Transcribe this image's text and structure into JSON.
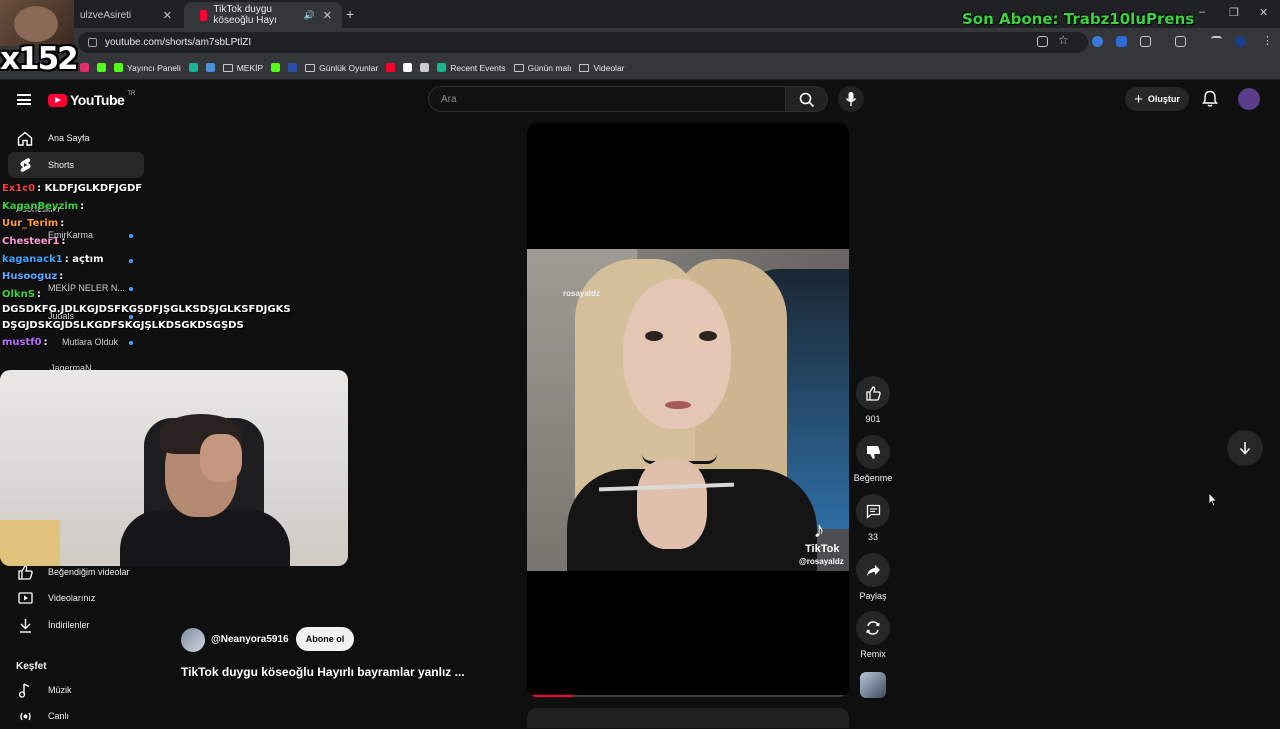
{
  "browser": {
    "tabs": [
      {
        "title": "ulzveAsireti"
      },
      {
        "title": "TikTok duygu köseoğlu Hayı"
      }
    ],
    "new_tab": "+",
    "url": "youtube.com/shorts/am7sbLPtlZI",
    "bookmarks": [
      {
        "label": "",
        "icon": "instagram-icon",
        "color": "#e1306c"
      },
      {
        "label": "",
        "icon": "kick-icon",
        "color": "#53fc18"
      },
      {
        "label": "Yayıncı Paneli",
        "icon": "kick-icon",
        "color": "#53fc18"
      },
      {
        "label": "",
        "icon": "app-icon",
        "color": "#1ab394"
      },
      {
        "label": "",
        "icon": "terminal-icon",
        "color": "#4a90d9"
      },
      {
        "label": "MEKİP",
        "icon": "folder-icon",
        "color": "#c7c7c7"
      },
      {
        "label": "",
        "icon": "kick-icon",
        "color": "#53fc18"
      },
      {
        "label": "",
        "icon": "app-icon",
        "color": "#2b4fa8"
      },
      {
        "label": "Günlük Oyunlar",
        "icon": "folder-icon",
        "color": "#c7c7c7"
      },
      {
        "label": "",
        "icon": "youtube-icon",
        "color": "#ff0033"
      },
      {
        "label": "",
        "icon": "game-icon",
        "color": "#ffffff"
      },
      {
        "label": "",
        "icon": "chatgpt-icon",
        "color": "#cccccc"
      },
      {
        "label": "Recent Events",
        "icon": "app-icon",
        "color": "#1ab394"
      },
      {
        "label": "Günün malı",
        "icon": "folder-icon",
        "color": "#c7c7c7"
      },
      {
        "label": "Videolar",
        "icon": "folder-icon",
        "color": "#c7c7c7"
      }
    ]
  },
  "overlay": {
    "sub_count": "x152",
    "sub_banner": "Son Abone: Trabz10luPrens",
    "chat": [
      {
        "user": "Ex1c0",
        "color": "#ff3b3b",
        "text": ": KLDFJGLKDFJGDF"
      },
      {
        "user": "KaganBeyzim",
        "color": "#3bd23f",
        "text": ":"
      },
      {
        "user": "Uur_Terim",
        "color": "#ff9a3c",
        "text": ":"
      },
      {
        "user": "Chesteer1",
        "color": "#ff9ad5",
        "text": ":"
      },
      {
        "user": "kaganack1",
        "color": "#3ea6ff",
        "text": ": açtım"
      },
      {
        "user": "Husooguz",
        "color": "#5aa9ff",
        "text": ":"
      },
      {
        "user": "OlknS",
        "color": "#3bd23f",
        "text": ":"
      },
      {
        "user": "",
        "color": "#ffffff",
        "text": "DGSDKFG.JDLKGJDSFKGŞDFJŞGLKSDŞJGLKSFDJGKS"
      },
      {
        "user": "",
        "color": "#ffffff",
        "text": "DŞGJDSKGJDSLKGDFSKGJŞLKDSGKDSGŞDS"
      },
      {
        "user": "mustf0",
        "color": "#b66cff",
        "text": ":"
      }
    ]
  },
  "youtube": {
    "brand": "YouTube",
    "country": "TR",
    "search_placeholder": "Ara",
    "create_label": "Oluştur",
    "sidebar": {
      "items": [
        {
          "label": "Ana Sayfa",
          "icon": "home-icon"
        },
        {
          "label": "Shorts",
          "icon": "shorts-icon"
        },
        {
          "label": "Beğendiğim videolar",
          "icon": "thumb-up-icon"
        },
        {
          "label": "Videolarınız",
          "icon": "video-icon"
        },
        {
          "label": "İndirilenler",
          "icon": "download-icon"
        },
        {
          "label": "Müzik",
          "icon": "music-icon"
        },
        {
          "label": "Canlı",
          "icon": "live-icon"
        }
      ],
      "subscriptions_ghost": [
        "EmirKarma",
        "MEKİP NELER N...",
        "Judals",
        "Mutlara Olduk",
        "JagermaN"
      ],
      "explore_heading": "Keşfet"
    },
    "short": {
      "watermark": "rosayaldz",
      "tiktok_word": "TikTok",
      "tiktok_handle": "@rosayaldz",
      "progress": 0.13,
      "channel": "@Neanyora5916",
      "subscribe_label": "Abone ol",
      "title": "TikTok duygu köseoğlu Hayırlı bayramlar yanlız ...",
      "actions": {
        "likes": "901",
        "dislike_label": "Beğenme",
        "comments": "33",
        "share_label": "Paylaş",
        "remix_label": "Remix"
      }
    }
  }
}
